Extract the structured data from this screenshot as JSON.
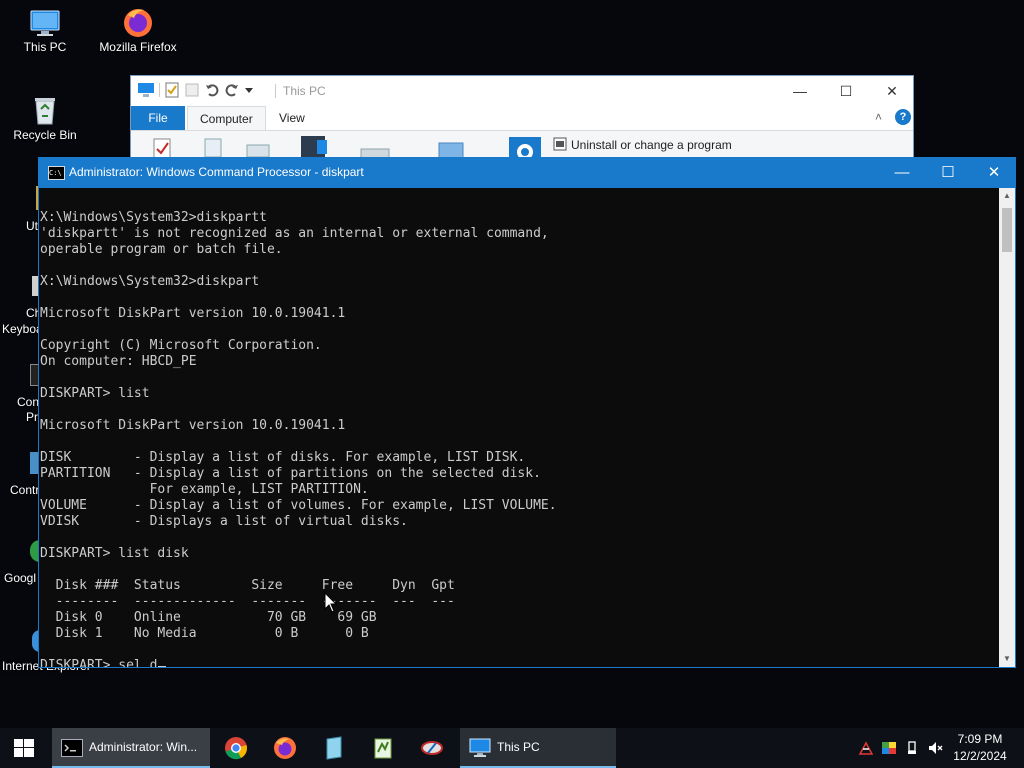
{
  "desktop": {
    "icons": [
      {
        "label": "This PC",
        "icon": "this-pc-icon"
      },
      {
        "label": "Mozilla Firefox",
        "icon": "firefox-icon"
      },
      {
        "label": "Recycle Bin",
        "icon": "recycle-bin-icon"
      }
    ],
    "partial_labels": [
      "Ut",
      "Ch",
      "Keyboa",
      "Con",
      "Pr",
      "Contr",
      "Googl",
      "Internet Explorer"
    ]
  },
  "explorer": {
    "title": "This PC",
    "tabs": [
      "File",
      "Computer",
      "View"
    ],
    "ribbon_action": "Uninstall or change a program"
  },
  "cmd": {
    "title": "Administrator: Windows Command Processor - diskpart",
    "lines": [
      "X:\\Windows\\System32>diskpartt",
      "'diskpartt' is not recognized as an internal or external command,",
      "operable program or batch file.",
      "",
      "X:\\Windows\\System32>diskpart",
      "",
      "Microsoft DiskPart version 10.0.19041.1",
      "",
      "Copyright (C) Microsoft Corporation.",
      "On computer: HBCD_PE",
      "",
      "DISKPART> list",
      "",
      "Microsoft DiskPart version 10.0.19041.1",
      "",
      "DISK        - Display a list of disks. For example, LIST DISK.",
      "PARTITION   - Display a list of partitions on the selected disk.",
      "              For example, LIST PARTITION.",
      "VOLUME      - Display a list of volumes. For example, LIST VOLUME.",
      "VDISK       - Displays a list of virtual disks.",
      "",
      "DISKPART> list disk",
      "",
      "  Disk ###  Status         Size     Free     Dyn  Gpt",
      "  --------  -------------  -------  -------  ---  ---",
      "  Disk 0    Online           70 GB    69 GB",
      "  Disk 1    No Media          0 B      0 B",
      "",
      "DISKPART> sel d"
    ]
  },
  "taskbar": {
    "tasks": [
      {
        "label": "Administrator: Win...",
        "icon": "cmd-icon"
      },
      {
        "label": "This PC",
        "icon": "this-pc-icon"
      }
    ],
    "pinned": [
      "chrome-icon",
      "firefox-icon",
      "notepad-icon",
      "notepadpp-icon",
      "tool-icon"
    ],
    "clock": {
      "time": "7:09 PM",
      "date": "12/2/2024"
    }
  },
  "colors": {
    "accent": "#1979ca",
    "console_bg": "#0c0c0c",
    "console_fg": "#cccccc"
  }
}
